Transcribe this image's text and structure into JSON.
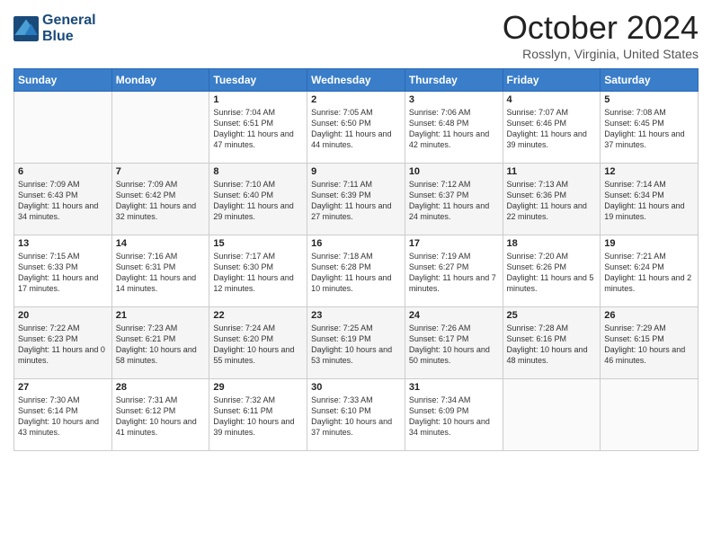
{
  "header": {
    "logo_line1": "General",
    "logo_line2": "Blue",
    "title": "October 2024",
    "subtitle": "Rosslyn, Virginia, United States"
  },
  "weekdays": [
    "Sunday",
    "Monday",
    "Tuesday",
    "Wednesday",
    "Thursday",
    "Friday",
    "Saturday"
  ],
  "weeks": [
    [
      {
        "day": "",
        "text": ""
      },
      {
        "day": "",
        "text": ""
      },
      {
        "day": "1",
        "text": "Sunrise: 7:04 AM\nSunset: 6:51 PM\nDaylight: 11 hours and 47 minutes."
      },
      {
        "day": "2",
        "text": "Sunrise: 7:05 AM\nSunset: 6:50 PM\nDaylight: 11 hours and 44 minutes."
      },
      {
        "day": "3",
        "text": "Sunrise: 7:06 AM\nSunset: 6:48 PM\nDaylight: 11 hours and 42 minutes."
      },
      {
        "day": "4",
        "text": "Sunrise: 7:07 AM\nSunset: 6:46 PM\nDaylight: 11 hours and 39 minutes."
      },
      {
        "day": "5",
        "text": "Sunrise: 7:08 AM\nSunset: 6:45 PM\nDaylight: 11 hours and 37 minutes."
      }
    ],
    [
      {
        "day": "6",
        "text": "Sunrise: 7:09 AM\nSunset: 6:43 PM\nDaylight: 11 hours and 34 minutes."
      },
      {
        "day": "7",
        "text": "Sunrise: 7:09 AM\nSunset: 6:42 PM\nDaylight: 11 hours and 32 minutes."
      },
      {
        "day": "8",
        "text": "Sunrise: 7:10 AM\nSunset: 6:40 PM\nDaylight: 11 hours and 29 minutes."
      },
      {
        "day": "9",
        "text": "Sunrise: 7:11 AM\nSunset: 6:39 PM\nDaylight: 11 hours and 27 minutes."
      },
      {
        "day": "10",
        "text": "Sunrise: 7:12 AM\nSunset: 6:37 PM\nDaylight: 11 hours and 24 minutes."
      },
      {
        "day": "11",
        "text": "Sunrise: 7:13 AM\nSunset: 6:36 PM\nDaylight: 11 hours and 22 minutes."
      },
      {
        "day": "12",
        "text": "Sunrise: 7:14 AM\nSunset: 6:34 PM\nDaylight: 11 hours and 19 minutes."
      }
    ],
    [
      {
        "day": "13",
        "text": "Sunrise: 7:15 AM\nSunset: 6:33 PM\nDaylight: 11 hours and 17 minutes."
      },
      {
        "day": "14",
        "text": "Sunrise: 7:16 AM\nSunset: 6:31 PM\nDaylight: 11 hours and 14 minutes."
      },
      {
        "day": "15",
        "text": "Sunrise: 7:17 AM\nSunset: 6:30 PM\nDaylight: 11 hours and 12 minutes."
      },
      {
        "day": "16",
        "text": "Sunrise: 7:18 AM\nSunset: 6:28 PM\nDaylight: 11 hours and 10 minutes."
      },
      {
        "day": "17",
        "text": "Sunrise: 7:19 AM\nSunset: 6:27 PM\nDaylight: 11 hours and 7 minutes."
      },
      {
        "day": "18",
        "text": "Sunrise: 7:20 AM\nSunset: 6:26 PM\nDaylight: 11 hours and 5 minutes."
      },
      {
        "day": "19",
        "text": "Sunrise: 7:21 AM\nSunset: 6:24 PM\nDaylight: 11 hours and 2 minutes."
      }
    ],
    [
      {
        "day": "20",
        "text": "Sunrise: 7:22 AM\nSunset: 6:23 PM\nDaylight: 11 hours and 0 minutes."
      },
      {
        "day": "21",
        "text": "Sunrise: 7:23 AM\nSunset: 6:21 PM\nDaylight: 10 hours and 58 minutes."
      },
      {
        "day": "22",
        "text": "Sunrise: 7:24 AM\nSunset: 6:20 PM\nDaylight: 10 hours and 55 minutes."
      },
      {
        "day": "23",
        "text": "Sunrise: 7:25 AM\nSunset: 6:19 PM\nDaylight: 10 hours and 53 minutes."
      },
      {
        "day": "24",
        "text": "Sunrise: 7:26 AM\nSunset: 6:17 PM\nDaylight: 10 hours and 50 minutes."
      },
      {
        "day": "25",
        "text": "Sunrise: 7:28 AM\nSunset: 6:16 PM\nDaylight: 10 hours and 48 minutes."
      },
      {
        "day": "26",
        "text": "Sunrise: 7:29 AM\nSunset: 6:15 PM\nDaylight: 10 hours and 46 minutes."
      }
    ],
    [
      {
        "day": "27",
        "text": "Sunrise: 7:30 AM\nSunset: 6:14 PM\nDaylight: 10 hours and 43 minutes."
      },
      {
        "day": "28",
        "text": "Sunrise: 7:31 AM\nSunset: 6:12 PM\nDaylight: 10 hours and 41 minutes."
      },
      {
        "day": "29",
        "text": "Sunrise: 7:32 AM\nSunset: 6:11 PM\nDaylight: 10 hours and 39 minutes."
      },
      {
        "day": "30",
        "text": "Sunrise: 7:33 AM\nSunset: 6:10 PM\nDaylight: 10 hours and 37 minutes."
      },
      {
        "day": "31",
        "text": "Sunrise: 7:34 AM\nSunset: 6:09 PM\nDaylight: 10 hours and 34 minutes."
      },
      {
        "day": "",
        "text": ""
      },
      {
        "day": "",
        "text": ""
      }
    ]
  ]
}
